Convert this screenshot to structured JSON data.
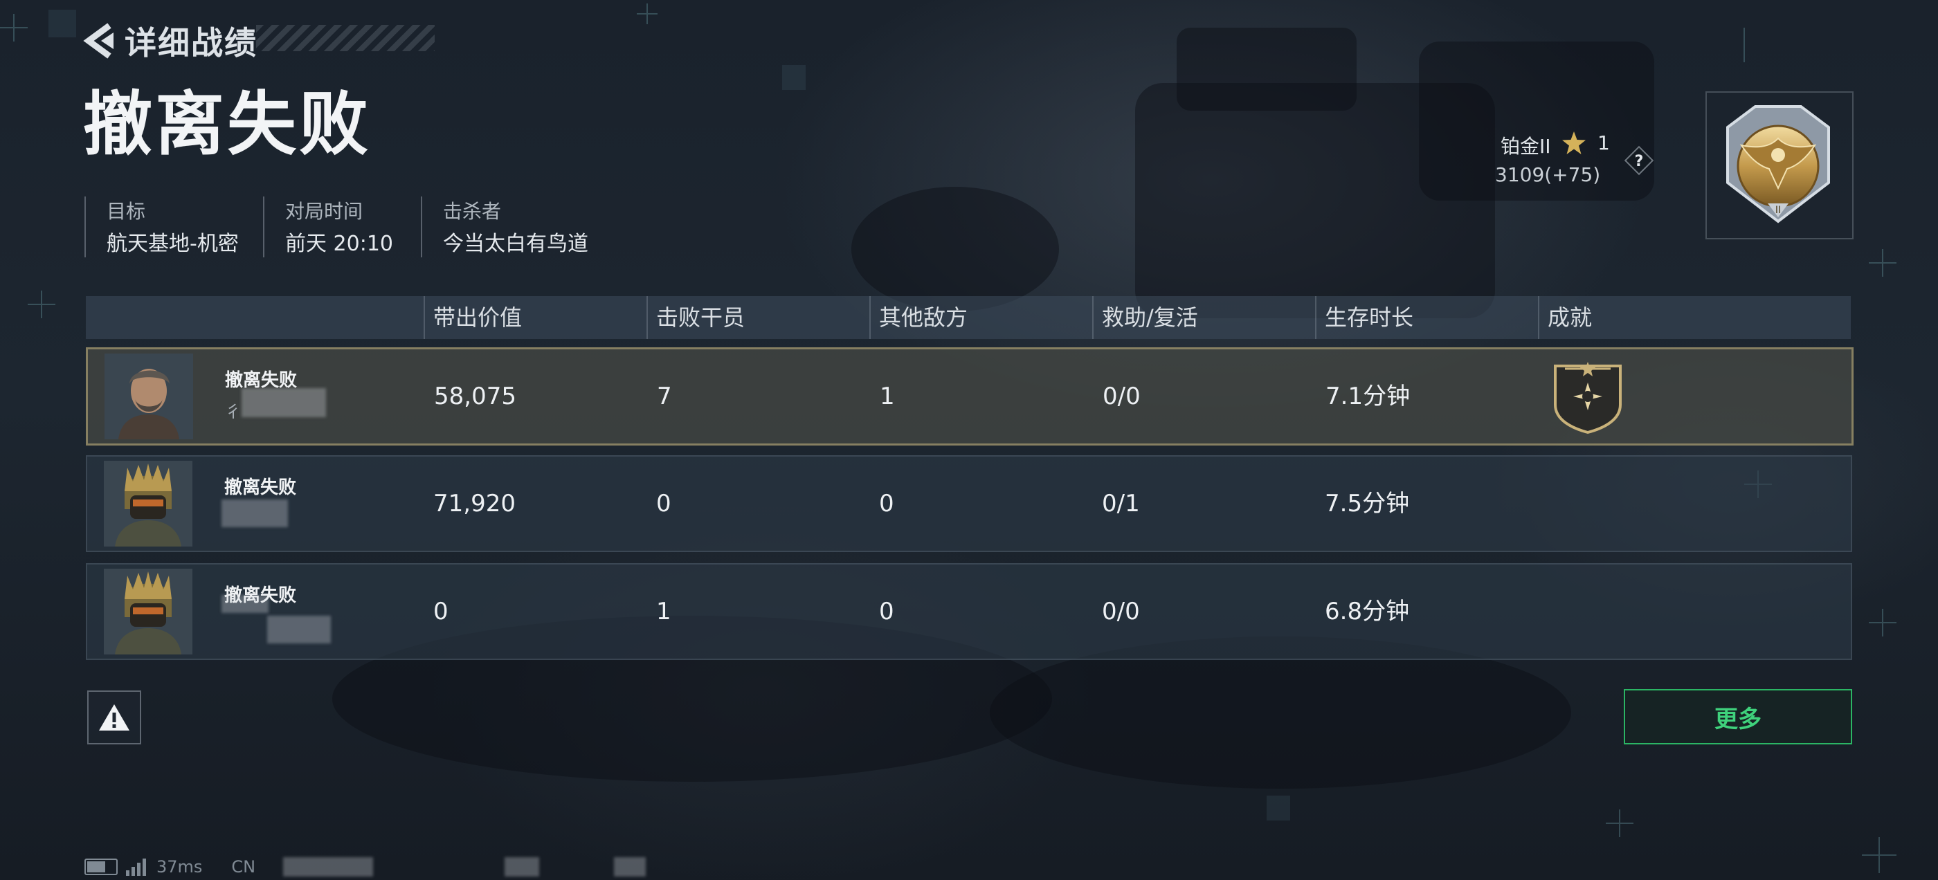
{
  "header": {
    "back_label": "详细战绩",
    "result_title": "撤离失败"
  },
  "match_info": [
    {
      "label": "目标",
      "value": "航天基地-机密"
    },
    {
      "label": "对局时间",
      "value": "前天 20:10"
    },
    {
      "label": "击杀者",
      "value": "今当太白有鸟道"
    }
  ],
  "rank": {
    "name": "铂金II",
    "stars": "1",
    "points": "3109(+75)",
    "help_icon": "question-icon",
    "emblem_icon": "platinum-eagle-emblem-icon"
  },
  "table": {
    "headers": [
      "带出价值",
      "击败干员",
      "其他敌方",
      "救助/复活",
      "生存时长",
      "成就"
    ],
    "rows": [
      {
        "status": "撤离失败",
        "name_partial": "彳",
        "value": "58,075",
        "operators": "7",
        "other": "1",
        "assist": "0/0",
        "time": "7.1分钟",
        "achievement": "star-shield-badge-icon",
        "is_self": true
      },
      {
        "status": "撤离失败",
        "name_partial": "",
        "value": "71,920",
        "operators": "0",
        "other": "0",
        "assist": "0/1",
        "time": "7.5分钟",
        "achievement": "",
        "is_self": false
      },
      {
        "status": "撤离失败",
        "name_partial": "",
        "value": "0",
        "operators": "1",
        "other": "0",
        "assist": "0/0",
        "time": "6.8分钟",
        "achievement": "",
        "is_self": false
      }
    ]
  },
  "actions": {
    "report_icon": "warning-icon",
    "more_label": "更多"
  },
  "status_bar": {
    "ping": "37ms",
    "region": "CN"
  },
  "colors": {
    "accent_green": "#3fd27c",
    "self_row_border": "#a09670",
    "gold_star": "#d4b25a"
  }
}
